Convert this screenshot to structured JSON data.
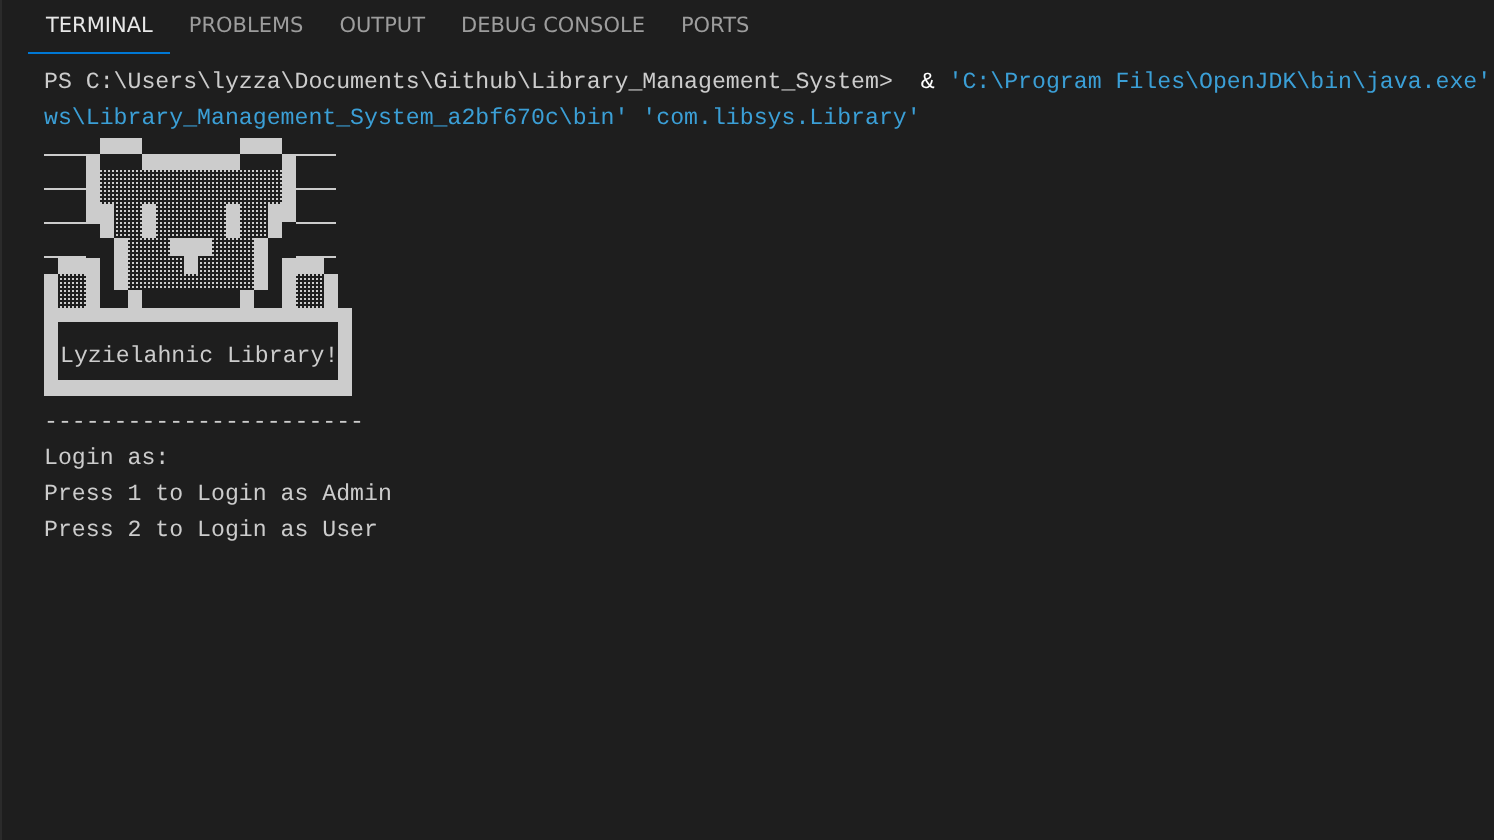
{
  "tabs": [
    {
      "label": "TERMINAL",
      "selected": true
    },
    {
      "label": "PROBLEMS",
      "selected": false
    },
    {
      "label": "OUTPUT",
      "selected": false
    },
    {
      "label": "DEBUG CONSOLE",
      "selected": false
    },
    {
      "label": "PORTS",
      "selected": false
    }
  ],
  "terminal": {
    "command_lines": [
      {
        "segments": [
          {
            "kind": "prompt",
            "text": "PS C:\\Users\\lyzza\\Documents\\Github\\Library_Management_System>"
          },
          {
            "kind": "operator",
            "text": "  & "
          },
          {
            "kind": "string",
            "text": "'C:\\Program Files\\OpenJDK\\bin\\java.exe'"
          }
        ]
      },
      {
        "segments": [
          {
            "kind": "string",
            "text": "ws\\Library_Management_System_a2bf670c\\bin'"
          },
          {
            "kind": "string",
            "text": "'com.libsys.Library'"
          }
        ]
      }
    ],
    "banner": {
      "title": "Lyzielahnic Library!"
    },
    "output_lines": [
      "-----------------------",
      "Login as:",
      "Press 1 to Login as Admin",
      "Press 2 to Login as User"
    ]
  }
}
